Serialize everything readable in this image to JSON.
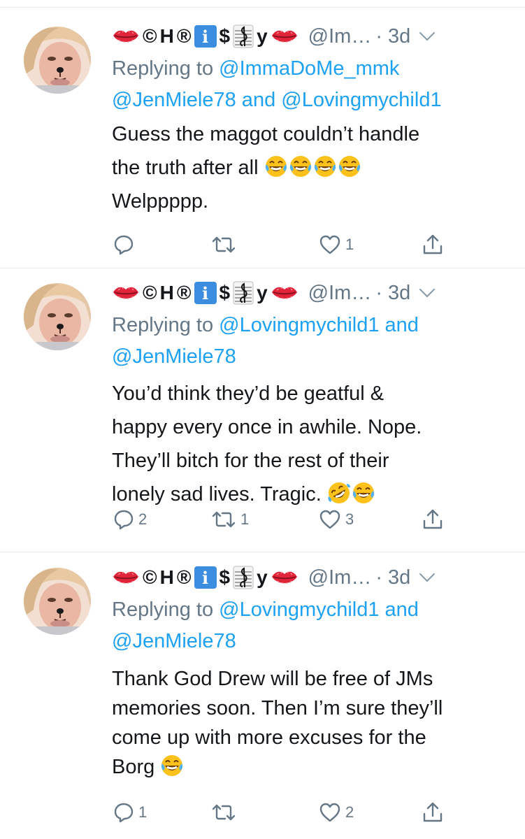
{
  "tweets": [
    {
      "display_name_letters": [
        "C",
        "H",
        "R",
        "i",
        "$",
        "y"
      ],
      "handle": "@Im…",
      "time": "· 3d",
      "reply_prefix": "Replying to ",
      "reply_mentions_line1": "@ImmaDoMe_mmk",
      "reply_line2": "@JenMiele78 and @Lovingmychild1",
      "body_lines": [
        "Guess the maggot couldn’t handle",
        "the truth after all",
        "Welppppp."
      ],
      "reply_count": "",
      "retweet_count": "",
      "like_count": "1"
    },
    {
      "display_name_letters": [
        "C",
        "H",
        "R",
        "i",
        "$",
        "y"
      ],
      "handle": "@Im…",
      "time": "· 3d",
      "reply_prefix": "Replying to ",
      "reply_mentions_line1": "@Lovingmychild1 and",
      "reply_line2": "@JenMiele78",
      "body_lines": [
        "You’d think they’d be geatful &",
        "happy every once in awhile. Nope.",
        "They’ll bitch for the rest of their",
        "lonely sad lives. Tragic."
      ],
      "reply_count": "2",
      "retweet_count": "1",
      "like_count": "3"
    },
    {
      "display_name_letters": [
        "C",
        "H",
        "R",
        "i",
        "$",
        "y"
      ],
      "handle": "@Im…",
      "time": "· 3d",
      "reply_prefix": "Replying to ",
      "reply_mentions_line1": "@Lovingmychild1 and",
      "reply_line2": "@JenMiele78",
      "body_lines": [
        "Thank God Drew will be free of JMs",
        "memories soon. Then I’m sure they’ll",
        "come up with more excuses for the",
        "Borg"
      ],
      "reply_count": "1",
      "retweet_count": "",
      "like_count": "2"
    }
  ],
  "icons": {
    "lips": "kiss-mark-icon",
    "copyright": "©",
    "registered": "®",
    "info": "information-icon",
    "music": "music-staff-icon",
    "laugh": "face-with-tears-of-joy-icon",
    "rofl": "rolling-on-floor-laughing-icon",
    "reply": "reply-icon",
    "retweet": "retweet-icon",
    "like": "heart-icon",
    "share": "share-icon"
  },
  "colors": {
    "link": "#1da1f2",
    "secondary": "#657786",
    "text": "#14171a",
    "separator": "#e6ecf0"
  }
}
